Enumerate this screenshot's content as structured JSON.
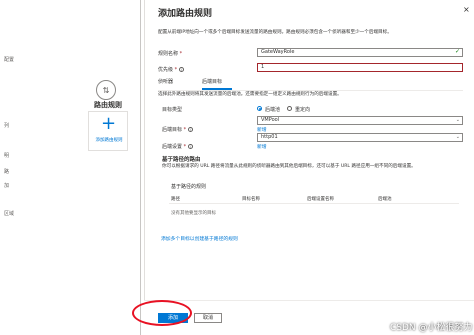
{
  "background": {
    "lines": [
      "配置",
      "列",
      "明",
      "路",
      "加",
      "区域"
    ],
    "route_card": {
      "title": "路由规则",
      "add_label": "添加路由规则"
    }
  },
  "panel": {
    "title": "添加路由规则",
    "close": "×",
    "description": "配置从前端IP地址向一个或多个后端目标发送流量的路由规则。路由规则必须包含一个侦听器和至少一个后端目标。",
    "rule_name": {
      "label": "规则名称",
      "value": "GateWayRole"
    },
    "priority": {
      "label": "优先级",
      "value": "1"
    },
    "tabs": [
      {
        "label": "侦听器"
      },
      {
        "label": "后端目标"
      }
    ],
    "tab_desc": "选择此外路由规则将其发送流量的后端池。还需要指定一组定义路由规则行为的后端设置。",
    "target_type": {
      "label": "目标类型",
      "options": [
        "后端池",
        "重定向"
      ],
      "selected": "后端池"
    },
    "backend_target": {
      "label": "后端目标",
      "value": "VMPool",
      "new_link": "新增"
    },
    "backend_settings": {
      "label": "后端设置",
      "value": "http01",
      "new_link": "新增"
    },
    "path_routing": {
      "title": "基于路径的路由",
      "desc": "你可以根据请求的 URL 路径将流量从此规则的侦听器路由到其他后端目标，还可以基于 URL 路径应用一组不同的后端设置。",
      "table_title": "基于路径的规则",
      "headers": [
        "路径",
        "目标名称",
        "后端设置名称",
        "后端池"
      ],
      "empty": "没有其他要显示的目标",
      "add_link": "添加多个目标以创建基于路径的规则"
    }
  },
  "footer": {
    "add": "添加",
    "cancel": "取消"
  },
  "watermark": "CSDN @小松很努力"
}
